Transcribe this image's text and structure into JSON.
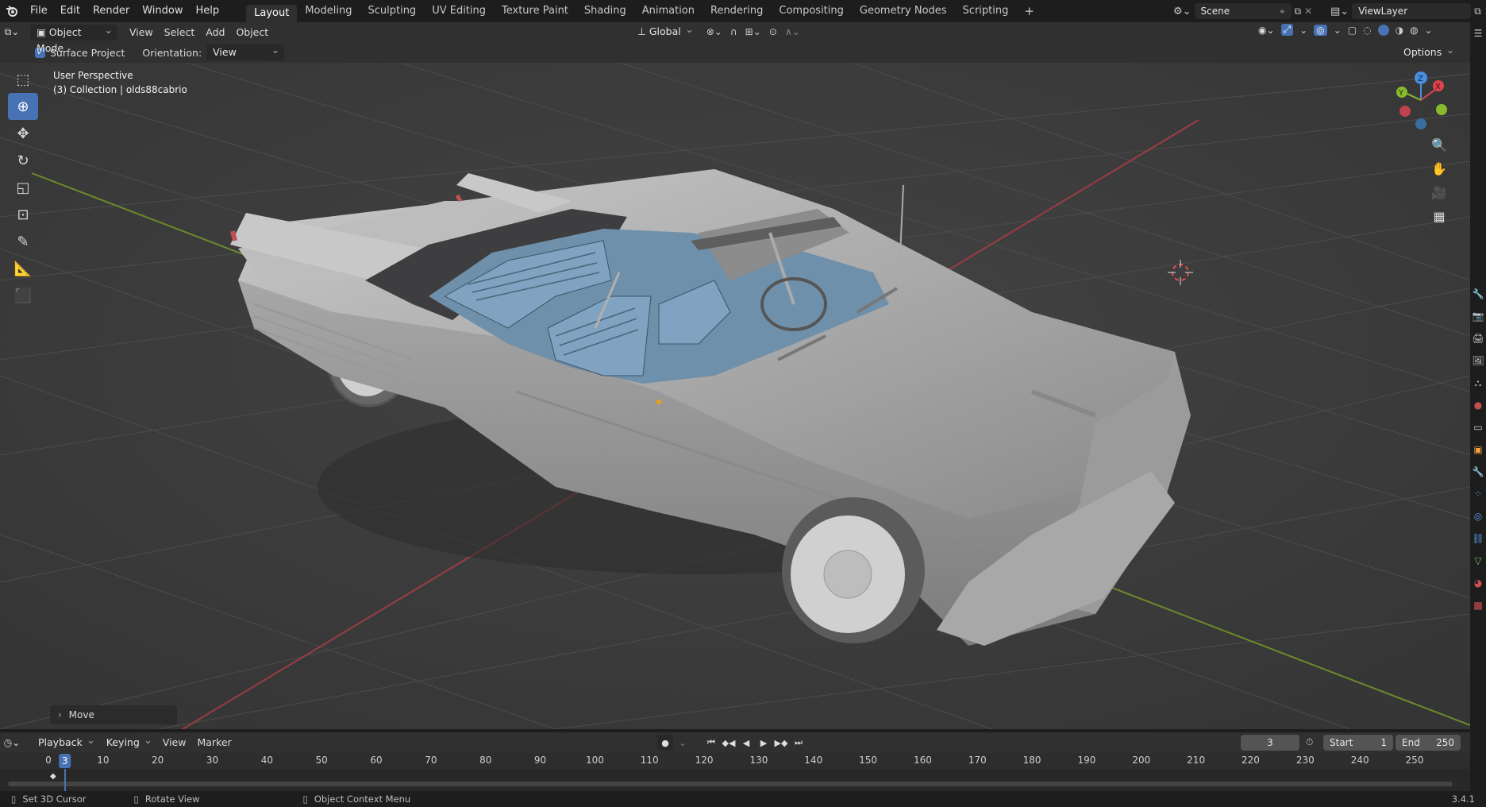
{
  "menubar": {
    "items": [
      "File",
      "Edit",
      "Render",
      "Window",
      "Help"
    ],
    "workspaces": [
      "Layout",
      "Modeling",
      "Sculpting",
      "UV Editing",
      "Texture Paint",
      "Shading",
      "Animation",
      "Rendering",
      "Compositing",
      "Geometry Nodes",
      "Scripting"
    ],
    "add_workspace": "+",
    "scene": "Scene",
    "view_layer": "ViewLayer"
  },
  "header": {
    "mode": "Object Mode",
    "menus": [
      "View",
      "Select",
      "Add",
      "Object"
    ],
    "transform_orientation": "Global",
    "options_label": "Options"
  },
  "tool_settings": {
    "surface_project_label": "Surface Project",
    "orientation_label": "Orientation:",
    "orientation_value": "View"
  },
  "viewport": {
    "perspective_label": "User Perspective",
    "collection_label": "(3) Collection | olds88cabrio",
    "last_operator": "Move",
    "gizmo_axes": [
      "X",
      "Y",
      "Z"
    ]
  },
  "timeline": {
    "menus": [
      "Playback",
      "Keying",
      "View",
      "Marker"
    ],
    "current_frame": "3",
    "start_label": "Start",
    "start_value": "1",
    "end_label": "End",
    "end_value": "250",
    "ticks": [
      "0",
      "10",
      "20",
      "30",
      "40",
      "50",
      "60",
      "70",
      "80",
      "90",
      "100",
      "110",
      "120",
      "130",
      "140",
      "150",
      "160",
      "170",
      "180",
      "190",
      "200",
      "210",
      "220",
      "230",
      "240",
      "250"
    ],
    "playhead": "3"
  },
  "statusbar": {
    "items": [
      "Set 3D Cursor",
      "Rotate View",
      "Object Context Menu"
    ],
    "version": "3.4.1"
  },
  "colors": {
    "accent": "#4772b3",
    "x_axis": "#e0434f",
    "y_axis": "#87ba2c",
    "z_axis": "#4a8ee0",
    "upholstery": "#7fa3c0"
  }
}
